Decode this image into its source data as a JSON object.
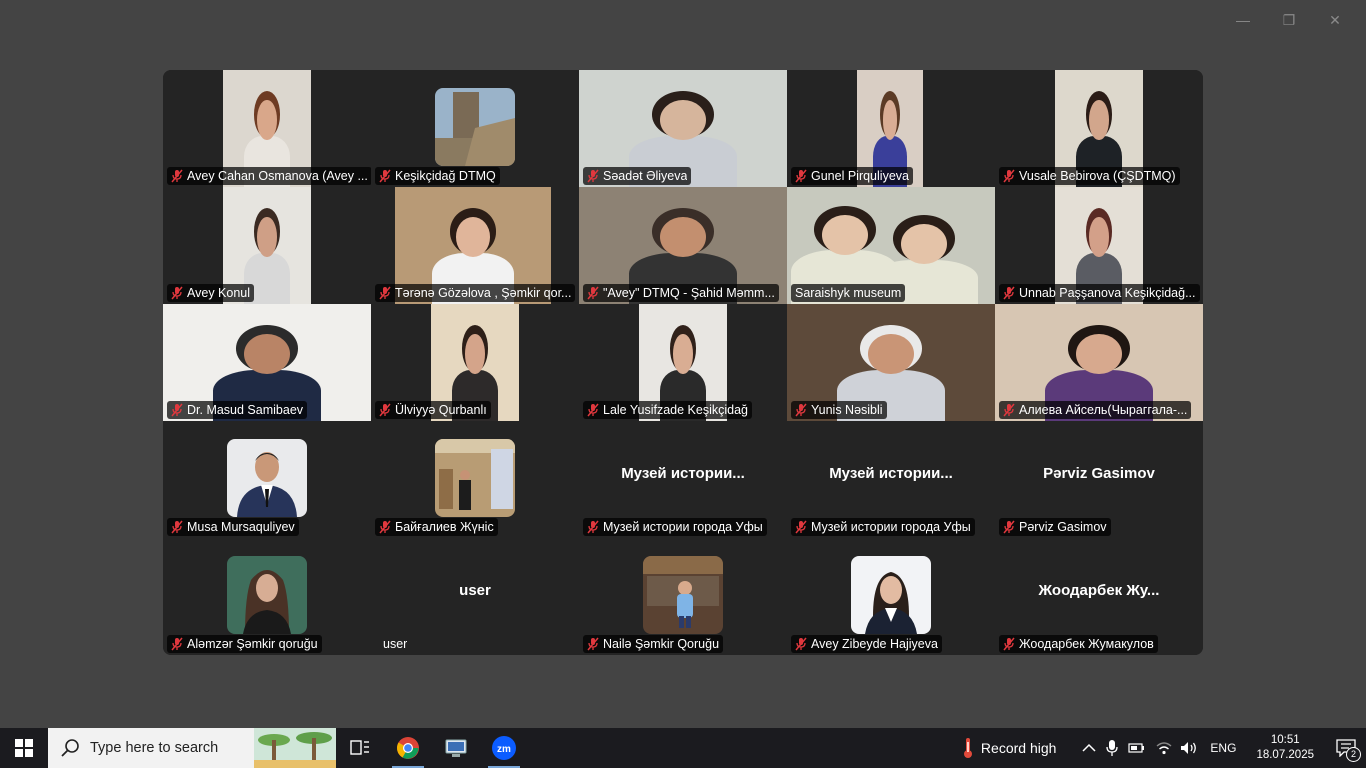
{
  "window_controls": {
    "minimize": "—",
    "restore": "❐",
    "close": "✕"
  },
  "participants": [
    {
      "name": "Avey Cahan Osmanova (Avey ...",
      "muted": true,
      "bg": "#dcd7cf",
      "skin": "#d9a78a",
      "shirt": "#e9e5df",
      "hair": "#6e3b23"
    },
    {
      "name": "Keşikçidağ DTMQ",
      "muted": true,
      "avatar": "tower"
    },
    {
      "name": "Səadət Əliyeva",
      "muted": true,
      "bg": "#cfd3cf",
      "skin": "#d6b59c",
      "shirt": "#c9cdd3",
      "hair": "#2a1f1a"
    },
    {
      "name": "Gunel Pirquliyeva",
      "muted": true,
      "bg": "#d9cec4",
      "skin": "#d9ad95",
      "shirt": "#3a3f9a",
      "hair": "#5b3a25"
    },
    {
      "name": "Vusale Bebirova (ÇŞDTMQ)",
      "muted": true,
      "bg": "#ddd8cc",
      "skin": "#d2a68c",
      "shirt": "#1e2226",
      "hair": "#2b1c16"
    },
    {
      "name": "Avey Konul",
      "muted": true,
      "bg": "#e6e4df",
      "skin": "#cf9f86",
      "shirt": "#d8d8d8",
      "hair": "#3b2a22"
    },
    {
      "name": "Tərənə Gözəlova , Şəmkir qor...",
      "muted": true,
      "bg": "#b89a76",
      "skin": "#e0b59a",
      "shirt": "#f2f2f2",
      "hair": "#2b1d16"
    },
    {
      "name": "\"Avey\" DTMQ - Şahid Məmm...",
      "muted": true,
      "bg": "#8d8274",
      "skin": "#c38f6f",
      "shirt": "#333333",
      "hair": "#3a2e28"
    },
    {
      "name": "Saraishyk museum",
      "muted": false,
      "active": true,
      "bg": "#c7c9be",
      "skin": "#e4c3a8",
      "shirt": "#e6e6d6",
      "hair": "#2a1e18"
    },
    {
      "name": "Unnab Paşşanova  Keşikçidağ...",
      "muted": true,
      "bg": "#e4dfd6",
      "skin": "#d3a089",
      "shirt": "#5a5c63",
      "hair": "#5a2a24"
    },
    {
      "name": "Dr. Masud Samibaev",
      "muted": true,
      "bg": "#f0efec",
      "skin": "#b98466",
      "shirt": "#1f2a44",
      "hair": "#2b2b2b"
    },
    {
      "name": "Ülviyyə Qurbanlı",
      "muted": true,
      "bg": "#e6d8c0",
      "skin": "#d4a48a",
      "shirt": "#2d2a2a",
      "hair": "#2d1f18"
    },
    {
      "name": "Lale Yusifzade Keşikçidağ",
      "muted": true,
      "bg": "#e8e6e2",
      "skin": "#d9ad93",
      "shirt": "#2a2a2a",
      "hair": "#30211a"
    },
    {
      "name": "Yunis Nəsibli",
      "muted": true,
      "bg": "#5d4a3a",
      "skin": "#c99576",
      "shirt": "#cfd2d8",
      "hair": "#e9e9e9"
    },
    {
      "name": "Алиева Айсель(Чыраггала-...",
      "muted": true,
      "bg": "#d7c6b3",
      "skin": "#d7a98e",
      "shirt": "#5b3a7a",
      "hair": "#1f1612"
    },
    {
      "name": "Musa Mursaquliyev",
      "muted": true,
      "avatar": "suit"
    },
    {
      "name": "Байғалиев Жүніс",
      "muted": true,
      "avatar": "hall"
    },
    {
      "name": "Музей истории города Уфы",
      "display": "Музей  истории...",
      "muted": true
    },
    {
      "name": "Музей истории города Уфы",
      "display": "Музей  истории...",
      "muted": true
    },
    {
      "name": "Pərviz Gasimov",
      "display": "Pərviz Gasimov",
      "muted": true
    },
    {
      "name": "Aləmzər Şəmkir qoruğu",
      "muted": true,
      "avatar": "woman"
    },
    {
      "name": "user",
      "display": "user",
      "muted": false,
      "plain": true
    },
    {
      "name": "Nailə Şəmkir Qoruğu",
      "muted": true,
      "avatar": "child"
    },
    {
      "name": "Avey Zibeyde Hajiyeva",
      "muted": true,
      "avatar": "girl"
    },
    {
      "name": "Жоодарбек Жумакулов",
      "display": "Жоодарбек  Жу...",
      "muted": true
    }
  ],
  "taskbar": {
    "search_placeholder": "Type here to search",
    "apps": [
      "task-view-icon",
      "chrome-icon",
      "network-app-icon",
      "zoom-icon"
    ],
    "weather": "Record high",
    "language": "ENG",
    "time": "10:51",
    "date": "18.07.2025",
    "notifications": "2"
  },
  "colors": {
    "active_border": "#23d959",
    "muted_icon": "#e0383e",
    "taskbar": "#1b1b1f",
    "zoom": "#0b5cff"
  }
}
